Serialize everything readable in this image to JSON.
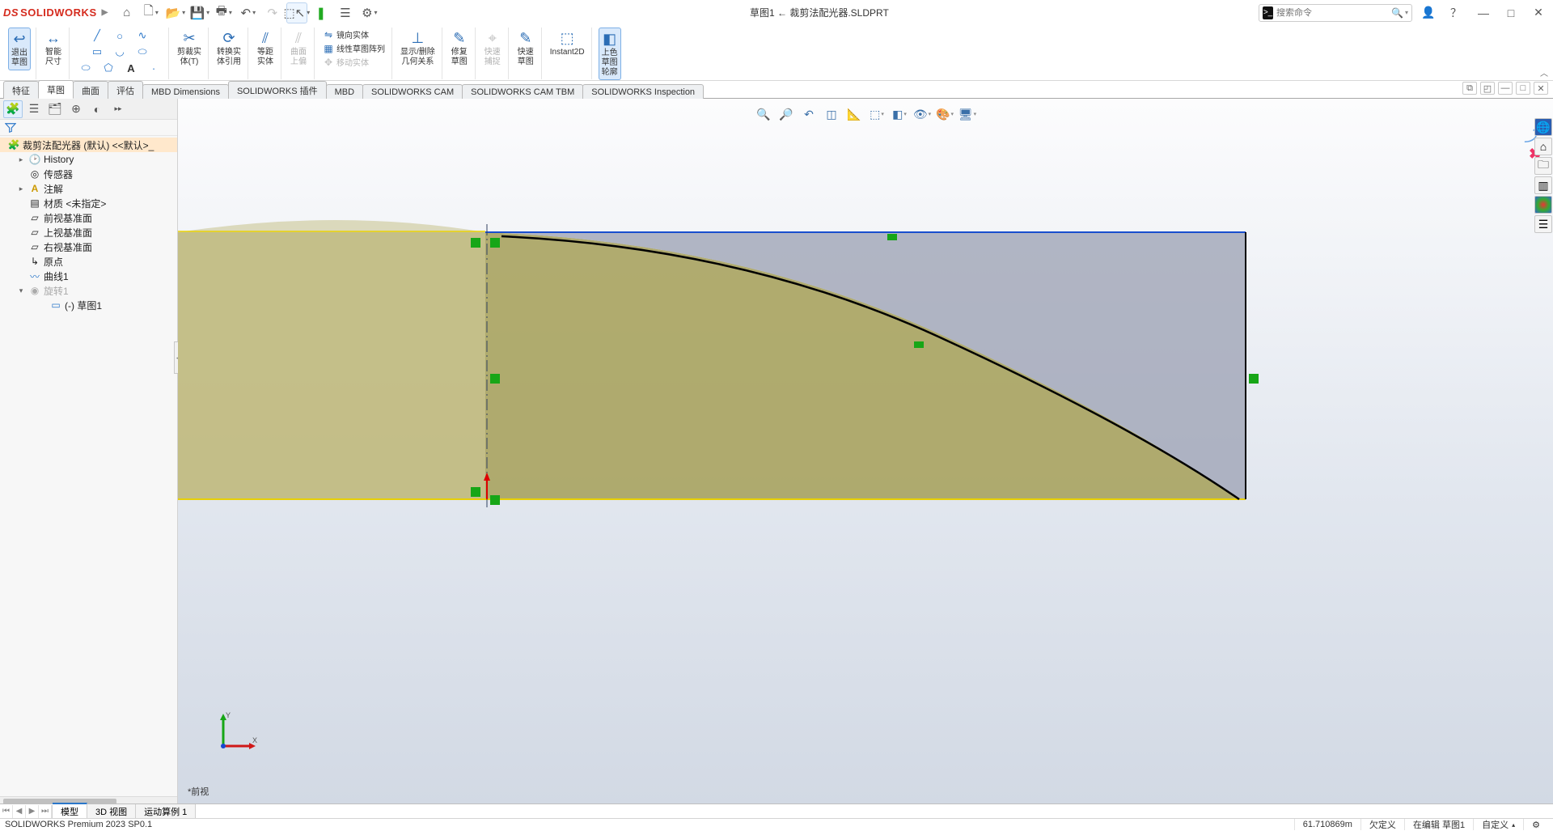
{
  "app": {
    "brand": "SOLIDWORKS",
    "title": "草图1 ← 裁剪法配光器.SLDPRT"
  },
  "search": {
    "placeholder": "搜索命令"
  },
  "ribbon": {
    "exit_sketch": "退出\n草图",
    "smart_dim": "智能\n尺寸",
    "trim": "剪裁实\n体(T)",
    "convert": "转换实\n体引用",
    "offset": "等距\n实体",
    "surface_offset": "曲面\n上偏",
    "mirror": "镜向实体",
    "linear_pattern": "线性草图阵列",
    "move": "移动实体",
    "display_delete": "显示/删除\n几何关系",
    "repair": "修复\n草图",
    "quick_snap": "快速\n捕捉",
    "rapid": "快速\n草图",
    "instant2d": "Instant2D",
    "shade": "上色\n草图\n轮廓"
  },
  "tabs": {
    "items": [
      "特征",
      "草图",
      "曲面",
      "评估",
      "MBD Dimensions",
      "SOLIDWORKS 插件",
      "MBD",
      "SOLIDWORKS CAM",
      "SOLIDWORKS CAM TBM",
      "SOLIDWORKS Inspection"
    ],
    "active_index": 1
  },
  "tree": {
    "root": "裁剪法配光器 (默认) <<默认>_",
    "history": "History",
    "sensors": "传感器",
    "annotations": "注解",
    "material": "材质 <未指定>",
    "front_plane": "前视基准面",
    "top_plane": "上视基准面",
    "right_plane": "右视基准面",
    "origin": "原点",
    "curve1": "曲线1",
    "revolve1": "旋转1",
    "sketch1": "(-) 草图1"
  },
  "view": {
    "label": "*前视",
    "axis_x": "X",
    "axis_y": "Y"
  },
  "bottom_tabs": {
    "items": [
      "模型",
      "3D 视图",
      "运动算例 1"
    ],
    "active_index": 0
  },
  "status": {
    "product": "SOLIDWORKS Premium 2023 SP0.1",
    "measure": "61.710869m",
    "under_defined": "欠定义",
    "editing": "在编辑 草图1",
    "custom": "自定义"
  }
}
